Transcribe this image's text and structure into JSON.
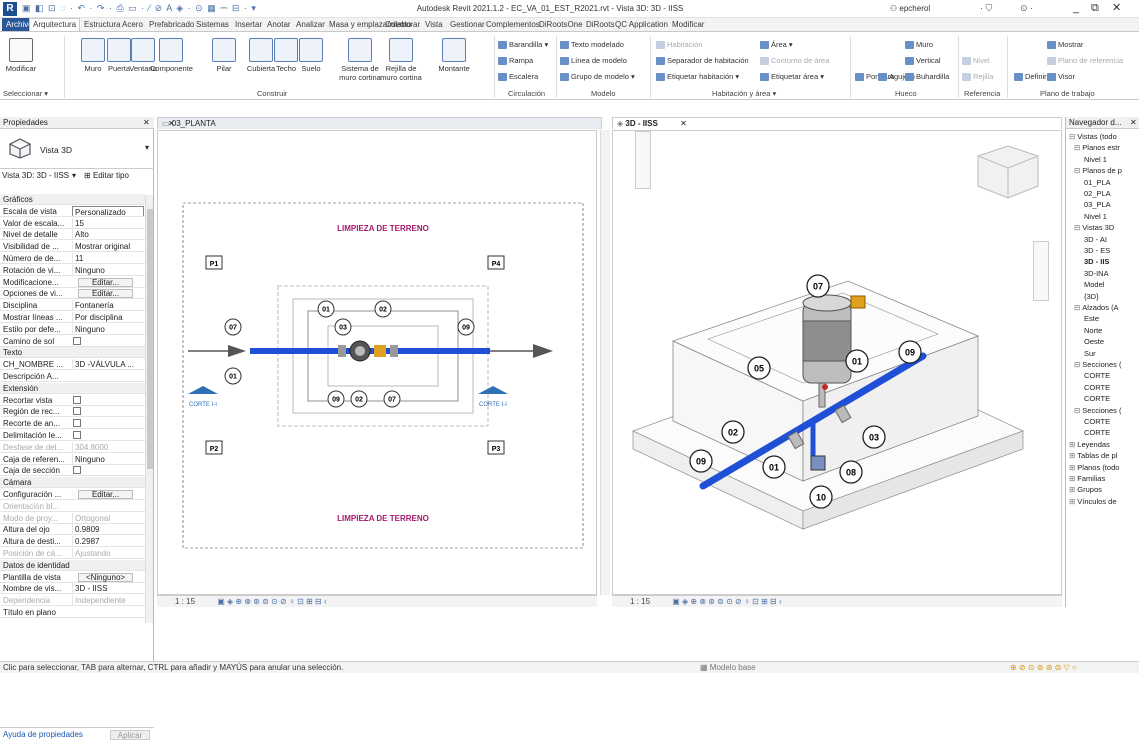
{
  "titlebar": {
    "qat_icons": "▣ ◧ ⊡ ◌ · ↶ · ↷ · ⎙ ▭ · ⁄ ⊘ A ◈ · ⊙ ▦ ⎓ ⊟ · ▾",
    "title": "Autodesk Revit 2021.1.2 - EC_VA_01_EST_R2021.rvt - Vista 3D: 3D - IISS",
    "user": "epcherol",
    "minimize": "_",
    "restore": "⧉",
    "close": "✕"
  },
  "tabs": [
    "Archivo",
    "Arquitectura",
    "Estructura",
    "Acero",
    "Prefabricado",
    "Sistemas",
    "Insertar",
    "Anotar",
    "Analizar",
    "Masa y emplazamiento",
    "Colaborar",
    "Vista",
    "Gestionar",
    "Complementos",
    "DiRootsOne",
    "DiRoots",
    "QC Application",
    "Modificar"
  ],
  "ribbon": {
    "modificar": "Modificar",
    "seleccionar": "Seleccionar ▾",
    "construir": [
      "Muro",
      "Puerta",
      "Ventana",
      "Componente",
      "Pilar",
      "Cubierta",
      "Techo",
      "Suelo",
      "Sistema de muro cortina",
      "Rejilla de muro cortina",
      "Montante"
    ],
    "construir_label": "Construir",
    "circulacion": [
      "Barandilla ▾",
      "Rampa",
      "Escalera"
    ],
    "circulacion_label": "Circulación",
    "modelo": [
      "Texto modelado",
      "Línea de modelo",
      "Grupo de modelo ▾"
    ],
    "modelo_label": "Modelo",
    "habitacion": [
      "Habitación",
      "Separador de habitación",
      "Etiquetar habitación ▾",
      "Área ▾",
      "Contorno de área",
      "Etiquetar área ▾"
    ],
    "habitacion_label": "Habitación y área ▾",
    "hueco": [
      "Por cara",
      "Agujero",
      "Muro",
      "Vertical",
      "Buhardilla"
    ],
    "hueco_label": "Hueco",
    "referencia": [
      "Nivel",
      "Rejilla"
    ],
    "referencia_label": "Referencia",
    "plano": [
      "Definir",
      "Mostrar",
      "Plano de referencia",
      "Visor"
    ],
    "plano_label": "Plano de trabajo"
  },
  "properties": {
    "header": "Propiedades",
    "type_name": "Vista 3D",
    "selector": "Vista 3D: 3D - IISS",
    "edit_type": "Editar tipo",
    "rows": [
      {
        "k": "Gráficos",
        "sec": true
      },
      {
        "k": "Escala de vista",
        "v": "Personalizado",
        "box": true
      },
      {
        "k": "Valor de escala...",
        "v": "15"
      },
      {
        "k": "Nivel de detalle",
        "v": "Alto"
      },
      {
        "k": "Visibilidad de ...",
        "v": "Mostrar original"
      },
      {
        "k": "Número de de...",
        "v": "11"
      },
      {
        "k": "Rotación de vi...",
        "v": "Ninguno"
      },
      {
        "k": "Modificacione...",
        "btn": "Editar..."
      },
      {
        "k": "Opciones de vi...",
        "btn": "Editar..."
      },
      {
        "k": "Disciplina",
        "v": "Fontanería"
      },
      {
        "k": "Mostrar líneas ...",
        "v": "Por disciplina"
      },
      {
        "k": "Estilo por defe...",
        "v": "Ninguno"
      },
      {
        "k": "Camino de sol",
        "chk": true
      },
      {
        "k": "Texto",
        "sec": true
      },
      {
        "k": "CH_NOMBRE ...",
        "v": "3D -VÁLVULA ..."
      },
      {
        "k": "Descripción A...",
        "v": ""
      },
      {
        "k": "Extensión",
        "sec": true
      },
      {
        "k": "Recortar vista",
        "chk": true
      },
      {
        "k": "Región de rec...",
        "chk": true
      },
      {
        "k": "Recorte de an...",
        "chk": true
      },
      {
        "k": "Delimitación le...",
        "chk": true
      },
      {
        "k": "Desfase de del...",
        "v": "304.8000",
        "dim": true
      },
      {
        "k": "Caja de referen...",
        "v": "Ninguno"
      },
      {
        "k": "Caja de sección",
        "chk": true
      },
      {
        "k": "Cámara",
        "sec": true
      },
      {
        "k": "Configuración ...",
        "btn": "Editar..."
      },
      {
        "k": "Orientación bl...",
        "v": "",
        "dim": true
      },
      {
        "k": "Modo de proy...",
        "v": "Ortogonal",
        "dim": true
      },
      {
        "k": "Altura del ojo",
        "v": "0.9809"
      },
      {
        "k": "Altura de desti...",
        "v": "0.2987"
      },
      {
        "k": "Posición de cá...",
        "v": "Ajustando",
        "dim": true
      },
      {
        "k": "Datos de identidad",
        "sec": true
      },
      {
        "k": "Plantilla de vista",
        "btn": "<Ninguno>"
      },
      {
        "k": "Nombre de vis...",
        "v": "3D - IISS"
      },
      {
        "k": "Dependencia",
        "v": "Independiente",
        "dim": true
      },
      {
        "k": "Título en plano",
        "v": ""
      }
    ],
    "help_link": "Ayuda de propiedades",
    "apply": "Aplicar"
  },
  "view1": {
    "tab": "03_PLANTA",
    "close": "✕",
    "top_title": "LIMPIEZA DE TERRENO",
    "bottom_title": "LIMPIEZA DE TERRENO",
    "tags": [
      "P1",
      "P4",
      "P2",
      "P3"
    ],
    "bubbles": [
      "01",
      "02",
      "03",
      "07",
      "09",
      "09",
      "02",
      "07",
      "01"
    ],
    "corte_left": "CORTE I-I",
    "corte_right": "CORTE I-I",
    "scale": "1 : 15",
    "status_icons": "▣ ◈ ⊕ ⊗ ⊛ ⊜ ⊙ ⊘ ♀ ⊡ ⊞ ⊟ ‹"
  },
  "view2": {
    "tab": "3D - IISS",
    "close": "✕",
    "bubbles": [
      "07",
      "09",
      "01",
      "05",
      "02",
      "03",
      "09",
      "08",
      "01",
      "10"
    ],
    "scale": "1 : 15",
    "status_icons": "▣ ◈ ⊕ ⊗ ⊛ ⊜ ⊙ ⊘ ♀ ⊡ ⊞ ⊟ ‹"
  },
  "navigator": {
    "header": "Navegador d...",
    "close": "✕",
    "rows": [
      {
        "t": "Vistas (todo",
        "lvl": 0,
        "plus": "⊟"
      },
      {
        "t": "Planos estr",
        "lvl": 1,
        "plus": "⊟"
      },
      {
        "t": "Nivel 1",
        "lvl": 3
      },
      {
        "t": "Planos de p",
        "lvl": 1,
        "plus": "⊟"
      },
      {
        "t": "01_PLA",
        "lvl": 3
      },
      {
        "t": "02_PLA",
        "lvl": 3
      },
      {
        "t": "03_PLA",
        "lvl": 3
      },
      {
        "t": "Nivel 1",
        "lvl": 3
      },
      {
        "t": "Vistas 3D",
        "lvl": 1,
        "plus": "⊟"
      },
      {
        "t": "3D - AI",
        "lvl": 3
      },
      {
        "t": "3D - ES",
        "lvl": 3
      },
      {
        "t": "3D - IIS",
        "lvl": 3,
        "bold": true
      },
      {
        "t": "3D-INA",
        "lvl": 3
      },
      {
        "t": "Model",
        "lvl": 3
      },
      {
        "t": "{3D}",
        "lvl": 3
      },
      {
        "t": "Alzados (A",
        "lvl": 1,
        "plus": "⊟"
      },
      {
        "t": "Este",
        "lvl": 3
      },
      {
        "t": "Norte",
        "lvl": 3
      },
      {
        "t": "Oeste",
        "lvl": 3
      },
      {
        "t": "Sur",
        "lvl": 3
      },
      {
        "t": "Secciones (",
        "lvl": 1,
        "plus": "⊟"
      },
      {
        "t": "CORTE",
        "lvl": 3
      },
      {
        "t": "CORTE",
        "lvl": 3
      },
      {
        "t": "CORTE",
        "lvl": 3
      },
      {
        "t": "Secciones (",
        "lvl": 1,
        "plus": "⊟"
      },
      {
        "t": "CORTE",
        "lvl": 3
      },
      {
        "t": "CORTE",
        "lvl": 3
      },
      {
        "t": "Leyendas",
        "lvl": 0,
        "plus": "⊞"
      },
      {
        "t": "Tablas de pl",
        "lvl": 0,
        "plus": "⊞"
      },
      {
        "t": "Planos (todo",
        "lvl": 0,
        "plus": "⊞"
      },
      {
        "t": "Familias",
        "lvl": 0,
        "plus": "⊞"
      },
      {
        "t": "Grupos",
        "lvl": 0,
        "plus": "⊞"
      },
      {
        "t": "Vínculos de",
        "lvl": 0,
        "plus": "⊞"
      }
    ]
  },
  "statusbar": {
    "hint": "Clic para seleccionar, TAB para alternar, CTRL para añadir y MAYÚS para anular una selección.",
    "workset": "Modelo base",
    "right_icons": "⊕ ⊘ ⊙ ⊚ ⊛ ⊜ ▽ ○"
  },
  "colors": {
    "pipe": "#1f4fd6",
    "valve_gold": "#e0a020",
    "accent": "#2b5797"
  }
}
